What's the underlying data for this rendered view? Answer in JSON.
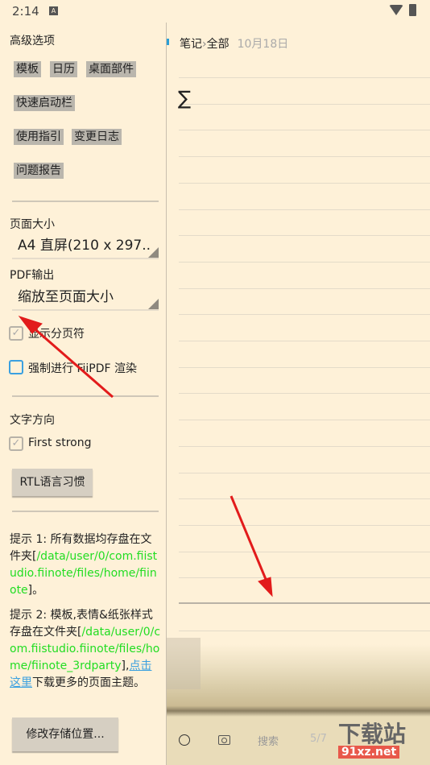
{
  "status": {
    "time": "2:14",
    "notif_icon": "A"
  },
  "sidebar": {
    "advanced_title": "高级选项",
    "chips": [
      "模板",
      "日历",
      "桌面部件",
      "快速启动栏",
      "使用指引",
      "变更日志",
      "问题报告"
    ],
    "page_size_label": "页面大小",
    "page_size_value": "A4 直屏(210 x 297..",
    "pdf_label": "PDF输出",
    "pdf_value": "缩放至页面大小",
    "show_page_break": {
      "label": "显示分页符",
      "checked": true
    },
    "force_fiipdf": {
      "label": "强制进行 FiiPDF 渲染",
      "checked": false
    },
    "text_dir_label": "文字方向",
    "first_strong": {
      "label": "First strong",
      "checked": true
    },
    "rtl_button": "RTL语言习惯",
    "tip1": {
      "prefix": "提示 1: 所有数据均存盘在文件夹[",
      "path": "/data/user/0/com.fiistudio.fiinote/files/home/fiinote",
      "suffix": "]。"
    },
    "tip2": {
      "prefix": "提示 2: 模板,表情&纸张样式存盘在文件夹[",
      "path": "/data/user/0/com.fiistudio.fiinote/files/home/fiinote_3rdparty",
      "suffix": "],",
      "link": "点击这里",
      "after": "下载更多的页面主题。"
    },
    "change_storage_button": "修改存储位置..."
  },
  "main": {
    "breadcrumb": [
      "笔记",
      "›",
      "全部"
    ],
    "date": "10月18日",
    "note_symbol": "∑",
    "bottom": {
      "search": "搜索",
      "page": "5/7"
    }
  },
  "watermark": {
    "title": "下载站",
    "site": "91xz.net"
  },
  "colors": {
    "background": "#fef1d8",
    "path_green": "#22dd22",
    "link_blue": "#3aa0e0",
    "arrow_red": "#e21b1b"
  }
}
